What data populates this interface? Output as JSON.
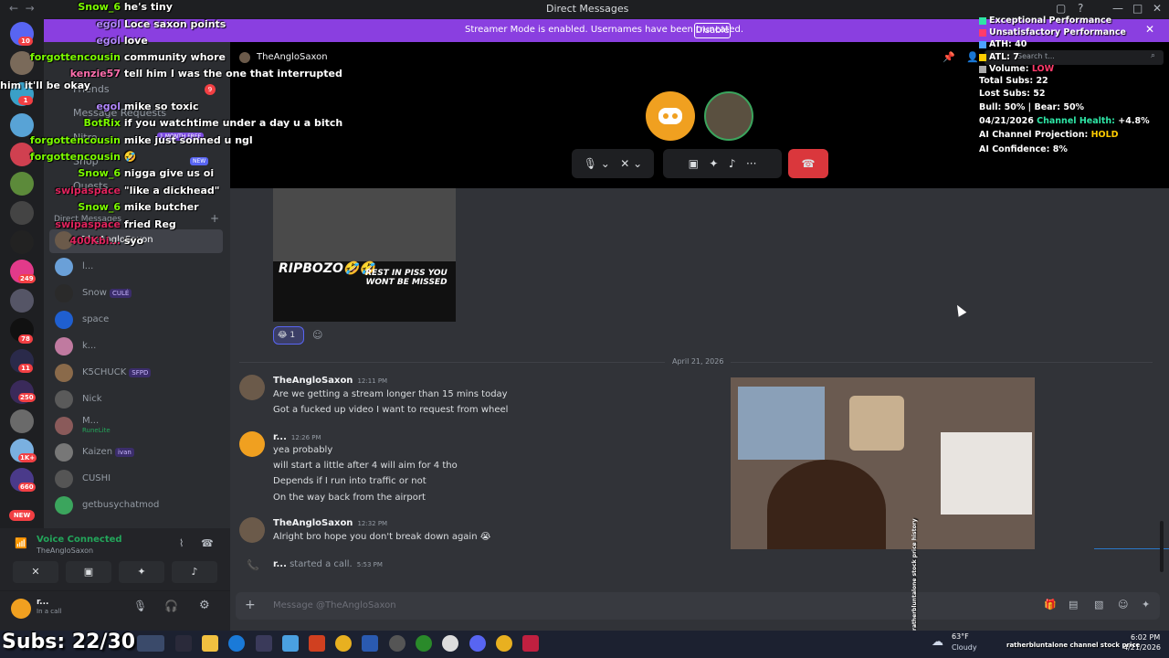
{
  "titlebar": {
    "title": "Direct Messages"
  },
  "banner": {
    "text": "Streamer Mode is enabled. Usernames have been truncated.",
    "button": "Disable"
  },
  "rail_badges": [
    "10",
    "1",
    "249",
    "78",
    "11",
    "250",
    "1K+",
    "660",
    "NEW"
  ],
  "sidebar": {
    "search_placeholder": "",
    "nav": [
      "Friends",
      "Message Requests",
      "Nitro",
      "Shop",
      "Quests"
    ],
    "shop_badge": "NEW",
    "nitro_badge": "1 MONTH FREE",
    "requests_badge": "9",
    "dm_header": "Direct Messages",
    "dms": [
      {
        "name": "TheAngloSaxon",
        "sub": ""
      },
      {
        "name": "l...",
        "sub": ""
      },
      {
        "name": "Snow",
        "tag": "CULÉ",
        "sub": ""
      },
      {
        "name": "space",
        "sub": ""
      },
      {
        "name": "k...",
        "sub": ""
      },
      {
        "name": "K5CHUCK",
        "tag": "SFPD",
        "sub": ""
      },
      {
        "name": "Nick",
        "sub": ""
      },
      {
        "name": "M...",
        "sub": "RuneLite"
      },
      {
        "name": "Kaizen",
        "tag": "ivan",
        "sub": ""
      },
      {
        "name": "CUSHI",
        "sub": ""
      },
      {
        "name": "getbusychatmod",
        "sub": ""
      }
    ]
  },
  "voice": {
    "status": "Voice Connected",
    "channel": "TheAngloSaxon"
  },
  "user": {
    "name": "r...",
    "status": "In a call"
  },
  "header": {
    "name": "TheAngloSaxon",
    "search_placeholder": "Search t..."
  },
  "messages": {
    "top_reaction_count": "1",
    "image_caption_1": "RIPBOZO🤣🤣",
    "image_caption_2": "REST IN PISS YOU WONT BE MISSED",
    "divider": "April 21, 2026",
    "groups": [
      {
        "author": "TheAngloSaxon",
        "time": "12:11 PM",
        "lines": [
          "Are we getting a stream longer than 15 mins today",
          "Got a fucked up video I want to request from wheel"
        ]
      },
      {
        "author": "r...",
        "time": "12:26 PM",
        "lines": [
          "yea probably",
          "will start a little after 4 will aim for 4 tho",
          "Depends if I run into traffic or not",
          "On the way back from the airport"
        ]
      },
      {
        "author": "TheAngloSaxon",
        "time": "12:32 PM",
        "lines": [
          "Alright bro hope you don't break down again 😭"
        ]
      }
    ],
    "call_user": "r...",
    "call_text": "started a call.",
    "call_time": "5:53 PM"
  },
  "composer": {
    "placeholder": "Message @TheAngloSaxon"
  },
  "chat_overlay": [
    {
      "name": "Snow_6",
      "color": "#7cfc00",
      "text": "he's tiny"
    },
    {
      "name": "egol",
      "color": "#b388ff",
      "text": "Loce saxon points"
    },
    {
      "name": "egol",
      "color": "#b388ff",
      "text": "love"
    },
    {
      "name": "forgottencousin",
      "color": "#7cfc00",
      "text": "community whore"
    },
    {
      "name": "kenzie57",
      "color": "#ff6fae",
      "text": "tell him I was the one that interrupted him it'll be okay"
    },
    {
      "name": "egol",
      "color": "#b388ff",
      "text": "mike so toxic"
    },
    {
      "name": "BotRix",
      "color": "#7cfc00",
      "text": "if you watchtime under a day u a bitch"
    },
    {
      "name": "forgottencousin",
      "color": "#7cfc00",
      "text": "mike just sonned u ngl"
    },
    {
      "name": "forgottencousin",
      "color": "#7cfc00",
      "text": "🤣"
    },
    {
      "name": "Snow_6",
      "color": "#7cfc00",
      "text": "nigga give us oi"
    },
    {
      "name": "swipaspace",
      "color": "#e0245e",
      "text": "\"like a dickhead\""
    },
    {
      "name": "Snow_6",
      "color": "#7cfc00",
      "text": "mike butcher"
    },
    {
      "name": "swipaspace",
      "color": "#e0245e",
      "text": "fried Reg"
    },
    {
      "name": "400Kbi...",
      "color": "#e0245e",
      "text": "syo"
    }
  ],
  "stats": {
    "legend_good": "Exceptional Performance",
    "legend_bad": "Unsatisfactory Performance",
    "ath_label": "ATH:",
    "ath": "40",
    "atl_label": "ATL:",
    "atl": "7",
    "volume_label": "Volume:",
    "volume": "LOW",
    "total_subs_label": "Total Subs:",
    "total_subs": "22",
    "lost_subs_label": "Lost Subs:",
    "lost_subs": "52",
    "bull_bear": "Bull: 50% | Bear: 50%",
    "date": "04/21/2026",
    "health_label": "Channel Health:",
    "health": "+4.8%",
    "projection_label": "AI Channel Projection:",
    "projection": "HOLD",
    "confidence_label": "AI Confidence:",
    "confidence": "8%",
    "colors": {
      "good": "#2ee6a6",
      "bad": "#ff3b6b",
      "ath": "#4da3ff",
      "atl": "#ffcc00",
      "volume": "#aaaaaa"
    }
  },
  "overlay": {
    "subs": "Subs: 22/30",
    "vertical_1": "ratherbluntalone stock price history",
    "vertical_2": "ratherbluntalone channel stock price"
  },
  "taskbar": {
    "weather_temp": "63°F",
    "weather_desc": "Cloudy",
    "time": "6:02 PM",
    "date": "4/21/2026"
  }
}
